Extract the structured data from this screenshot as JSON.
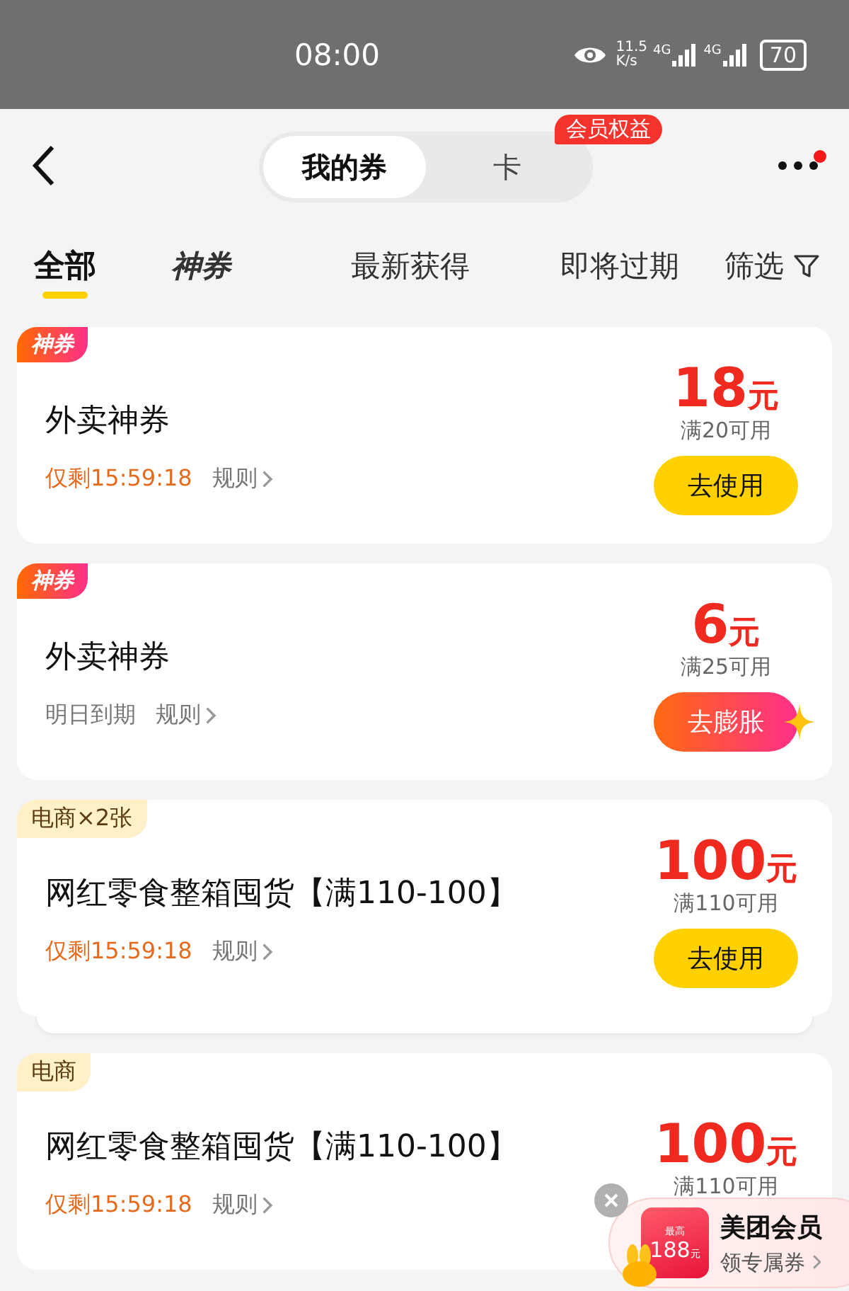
{
  "status_bar": {
    "time": "08:00",
    "speed": "11.5",
    "speed_unit": "K/s",
    "networks": [
      "4G",
      "4G"
    ],
    "battery": "70"
  },
  "header": {
    "segments": [
      {
        "label": "我的券",
        "selected": true
      },
      {
        "label": "卡",
        "selected": false
      }
    ],
    "badge": "会员权益",
    "has_notification": true
  },
  "filter_tabs": [
    {
      "label": "全部",
      "kind": "text",
      "selected": true
    },
    {
      "label": "神券",
      "kind": "logo",
      "selected": false
    },
    {
      "label": "最新获得",
      "kind": "text",
      "selected": false
    },
    {
      "label": "即将过期",
      "kind": "text",
      "selected": false
    },
    {
      "label": "筛选",
      "kind": "filter",
      "selected": false
    }
  ],
  "coupons": [
    {
      "tag": {
        "text": "神券",
        "kind": "shen"
      },
      "title": "外卖神券",
      "expiry": "仅剩15:59:18",
      "expiry_urgent": true,
      "rule": "规则",
      "amount": "18",
      "unit": "元",
      "condition": "满20可用",
      "button": {
        "label": "去使用",
        "kind": "use"
      },
      "stacked": false
    },
    {
      "tag": {
        "text": "神券",
        "kind": "shen"
      },
      "title": "外卖神券",
      "expiry": "明日到期",
      "expiry_urgent": false,
      "rule": "规则",
      "amount": "6",
      "unit": "元",
      "condition": "满25可用",
      "button": {
        "label": "去膨胀",
        "kind": "expand"
      },
      "stacked": false
    },
    {
      "tag": {
        "text": "电商×2张",
        "kind": "plain"
      },
      "title": "网红零食整箱囤货【满110-100】",
      "expiry": "仅剩15:59:18",
      "expiry_urgent": true,
      "rule": "规则",
      "amount": "100",
      "unit": "元",
      "condition": "满110可用",
      "button": {
        "label": "去使用",
        "kind": "use"
      },
      "stacked": true
    },
    {
      "tag": {
        "text": "电商",
        "kind": "plain"
      },
      "title": "网红零食整箱囤货【满110-100】",
      "expiry": "仅剩15:59:18",
      "expiry_urgent": true,
      "rule": "规则",
      "amount": "100",
      "unit": "元",
      "condition": "满110可用",
      "stacked": false
    }
  ],
  "promo": {
    "badge_top": "最高",
    "badge_amount": "188",
    "badge_unit": "元",
    "title": "美团会员",
    "subtitle": "领专属券"
  }
}
